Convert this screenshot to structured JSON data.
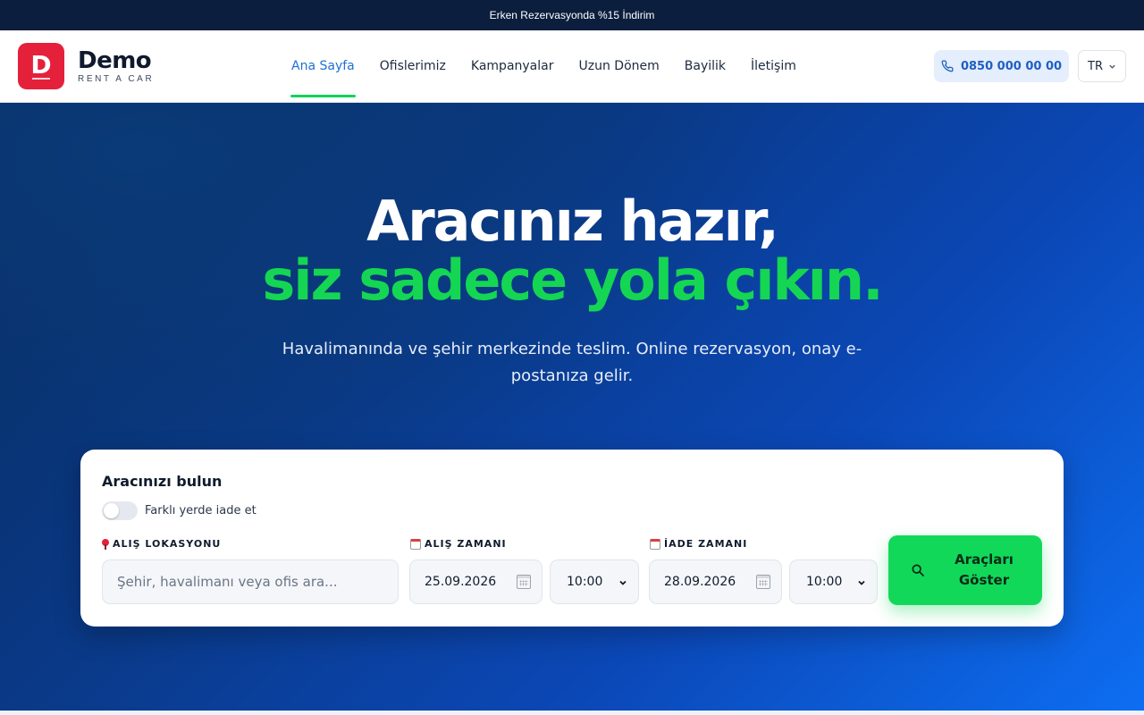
{
  "promo_bar": {
    "text": "Erken Rezervasyonda %15 İndirim"
  },
  "header": {
    "logo": {
      "letter": "D",
      "name": "Demo",
      "tagline": "RENT A CAR",
      "color": "#e5203b"
    },
    "nav": [
      {
        "label": "Ana Sayfa",
        "active": true
      },
      {
        "label": "Ofislerimiz",
        "active": false
      },
      {
        "label": "Kampanyalar",
        "active": false
      },
      {
        "label": "Uzun Dönem",
        "active": false
      },
      {
        "label": "Bayilik",
        "active": false
      },
      {
        "label": "İletişim",
        "active": false
      }
    ],
    "phone": {
      "label": "0850 000 00 00",
      "icon": "phone-icon"
    },
    "language": {
      "label": "TR",
      "icon": "chevron-down-icon"
    }
  },
  "hero": {
    "title_line1": "Aracınız hazır,",
    "title_line2": "siz sadece yola çıkın.",
    "subtitle": "Havalimanında ve şehir merkezinde teslim. Online rezervasyon, onay e-postanıza gelir.",
    "accent_color": "#14d653"
  },
  "search_form": {
    "title": "Aracınızı bulun",
    "return_toggle": {
      "label": "Farklı yerde iade et",
      "checked": false
    },
    "pickup_location": {
      "label": "ALIŞ LOKASYONU",
      "icon": "pin-icon",
      "placeholder": "Şehir, havalimanı veya ofis ara...",
      "value": ""
    },
    "pickup_time": {
      "label": "ALIŞ ZAMANI",
      "icon": "calendar-icon",
      "date": "25.09.2026",
      "time": "10:00"
    },
    "return_time": {
      "label": "İADE ZAMANI",
      "icon": "calendar-icon",
      "date": "28.09.2026",
      "time": "10:00"
    },
    "submit": {
      "label_line1": "Araçları",
      "label_line2": "Göster",
      "icon": "search-icon",
      "color": "#12d85a"
    }
  }
}
